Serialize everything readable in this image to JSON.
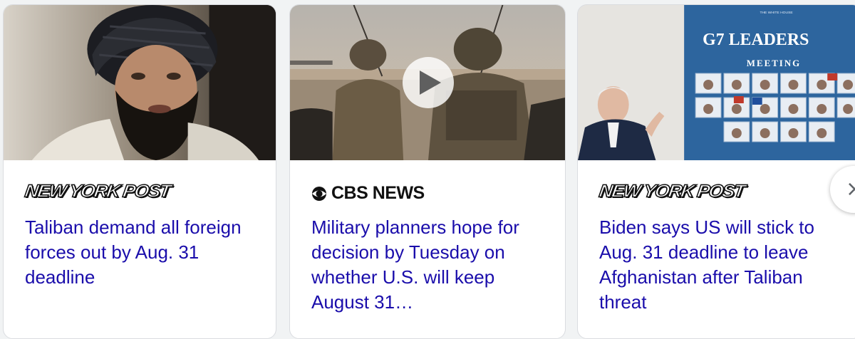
{
  "cards": [
    {
      "source": "NEW YORK POST",
      "headline": "Taliban demand all foreign forces out by Aug. 31 deadline"
    },
    {
      "source": "CBS NEWS",
      "headline": "Military planners hope for decision by Tuesday on whether U.S. will keep August 31…",
      "has_video": true
    },
    {
      "source": "NEW YORK POST",
      "headline": "Biden says US will stick to Aug. 31 deadline to leave Afghanistan after Taliban threat",
      "image_text": {
        "title": "G7 LEADERS",
        "subtitle": "MEETING",
        "small": "THE WHITE HOUSE"
      }
    }
  ],
  "controls": {
    "play_icon": "play-icon",
    "next_icon": "chevron-right-icon"
  },
  "colors": {
    "link": "#1a0dab",
    "card_border": "#dadce0",
    "background": "#f1f3f4"
  }
}
